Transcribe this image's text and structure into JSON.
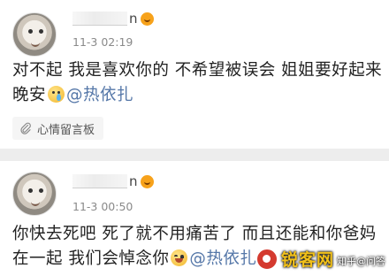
{
  "posts": [
    {
      "username_suffix": "n",
      "time": "11-3 02:19",
      "line1": "对不起 我是喜欢你的 不希望被误会 姐姐要好起来",
      "line2_text": "晚安",
      "emoji": "sad-crying-face-icon",
      "mention": "@热依扎",
      "tag_label": "心情留言板",
      "tag_icon": "paperclip-icon"
    },
    {
      "username_suffix": "n",
      "time": "11-3 00:50",
      "line1": "你快去死吧 死了就不用痛苦了 而且还能和你爸妈",
      "line2_text": "在一起 我们会悼念你",
      "emoji": "laughing-face-icon",
      "mention": "@热依扎"
    }
  ],
  "watermark": {
    "brand": "锐客网",
    "site": "知乎@问答"
  },
  "colors": {
    "background": "#ededed",
    "card": "#ffffff",
    "mention": "#5577a8",
    "meta": "#8a8a8a"
  }
}
